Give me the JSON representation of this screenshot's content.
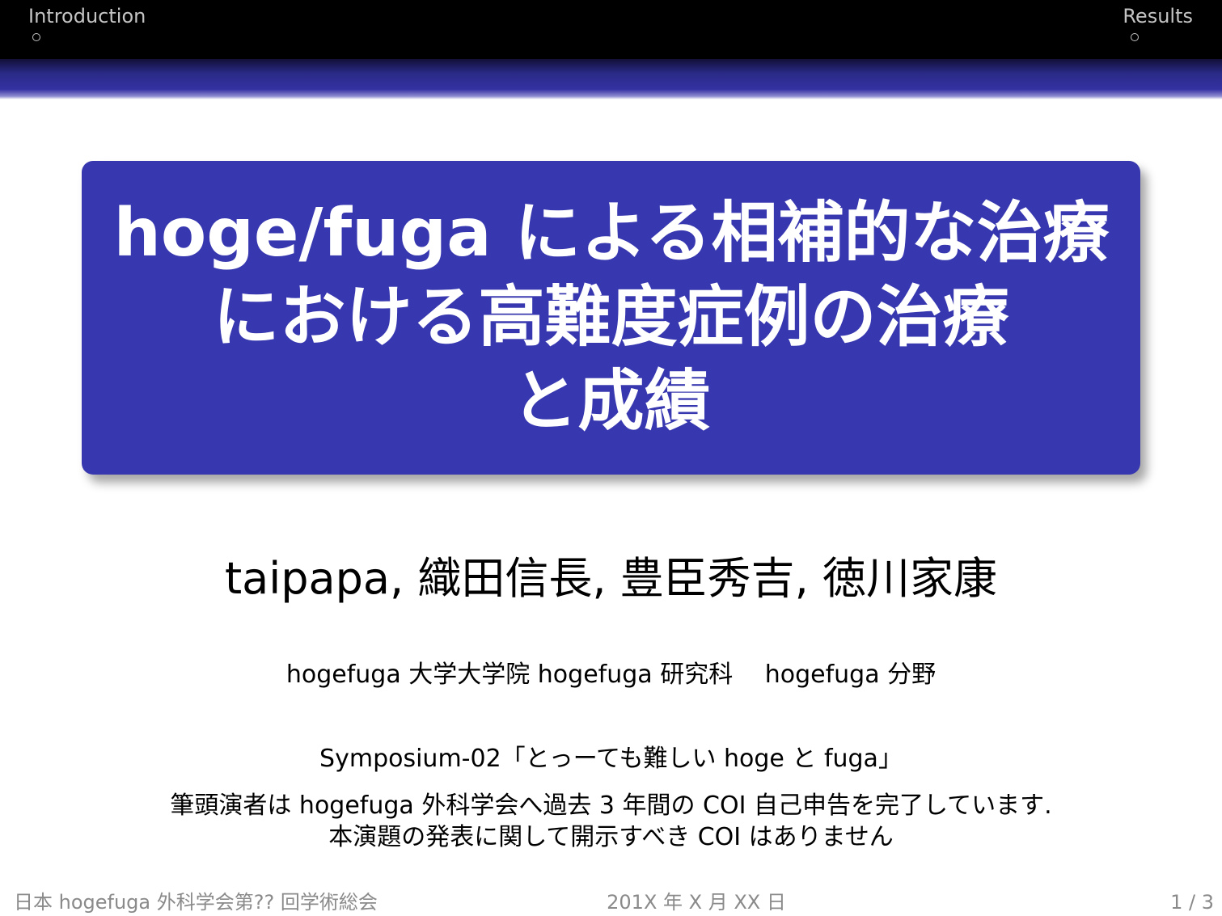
{
  "header": {
    "sections": [
      {
        "label": "Introduction"
      },
      {
        "label": "Results"
      }
    ]
  },
  "title": {
    "lines": [
      "hoge/fuga による相補的な治療",
      "における高難度症例の治療",
      "と成績"
    ]
  },
  "authors": "taipapa, 織田信長, 豊臣秀吉, 徳川家康",
  "affiliation": "hogefuga 大学大学院 hogefuga 研究科　 hogefuga 分野",
  "symposium": "Symposium-02「とっーても難しい hoge と fuga」",
  "coi": {
    "line1": "筆頭演者は hogefuga 外科学会へ過去 3 年間の COI 自己申告を完了しています.",
    "line2": "本演題の発表に関して開示すべき COI はありません"
  },
  "footer": {
    "conference": "日本 hogefuga 外科学会第?? 回学術総会",
    "date": "201X 年 X 月 XX 日",
    "page": "1 / 3"
  },
  "colors": {
    "title_box": "#3737b0",
    "header_bar": "#000000",
    "header_text": "#c4c4c4",
    "footer_text": "#8a8a8a"
  }
}
